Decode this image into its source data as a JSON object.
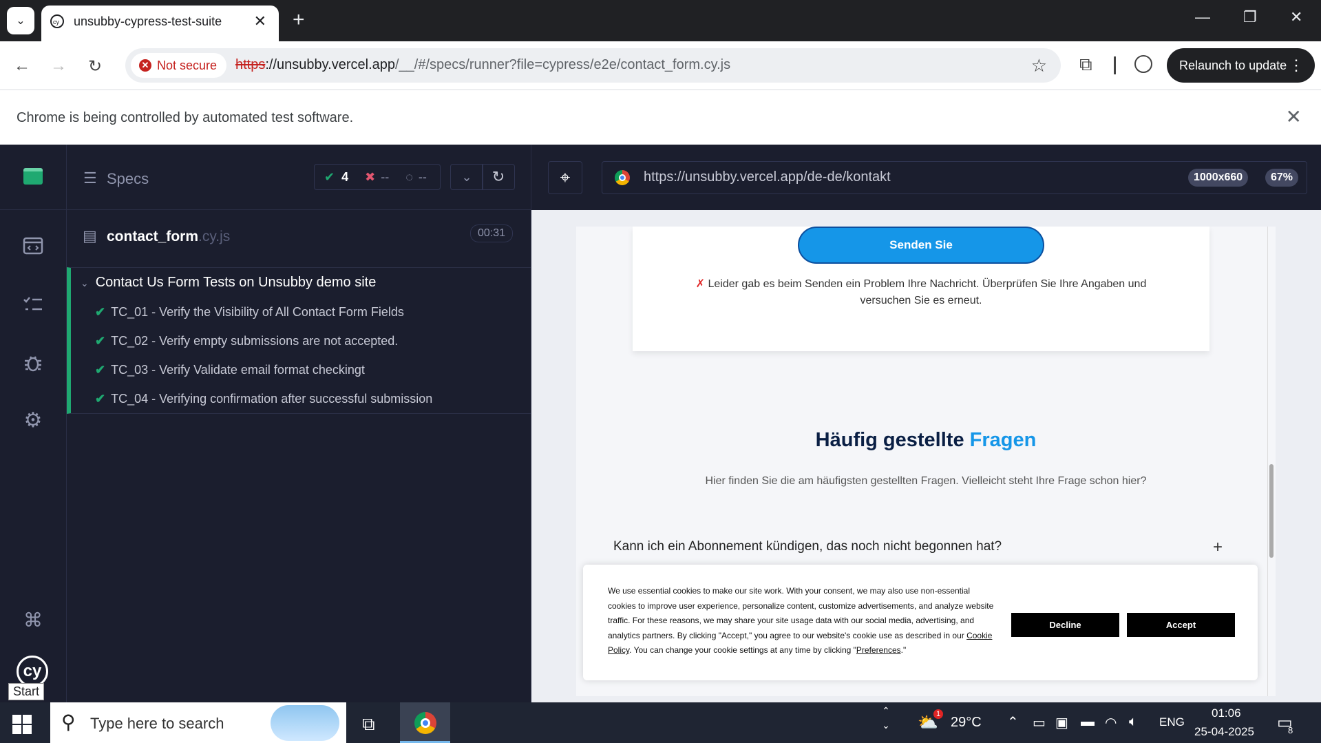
{
  "browser": {
    "tab_title": "unsubby-cypress-test-suite",
    "not_secure_label": "Not secure",
    "url_proto": "https",
    "url_host": "://unsubby.vercel.app",
    "url_path": "/__/#/specs/runner?file=cypress/e2e/contact_form.cy.js",
    "relaunch_label": "Relaunch to update",
    "infobar_message": "Chrome is being controlled by automated test software."
  },
  "cypress": {
    "specs_label": "Specs",
    "stats": {
      "passed": "4",
      "failed": "--",
      "pending": "--"
    },
    "spec_file_name": "contact_form",
    "spec_file_ext": ".cy.js",
    "duration": "00:31",
    "suite_title": "Contact Us Form Tests on Unsubby demo site",
    "tests": [
      {
        "title": "TC_01 - Verify the Visibility of All Contact Form Fields",
        "status": "passed"
      },
      {
        "title": "TC_02 - Verify empty submissions are not accepted.",
        "status": "passed"
      },
      {
        "title": "TC_03 - Verify Validate email format checkingt",
        "status": "passed"
      },
      {
        "title": "TC_04 - Verifying confirmation after successful submission",
        "status": "passed"
      }
    ],
    "aut_url": "https://unsubby.vercel.app/de-de/kontakt",
    "viewport_size": "1000x660",
    "zoom": "67%",
    "start_tooltip": "Start"
  },
  "aut_page": {
    "send_button": "Senden Sie",
    "error_mark": "✗",
    "error_message": "Leider gab es beim Senden ein Problem Ihre Nachricht. Überprüfen Sie Ihre Angaben und versuchen Sie es erneut.",
    "faq_title_main": "Häufig gestellte ",
    "faq_title_accent": "Fragen",
    "faq_subtitle": "Hier finden Sie die am häufigsten gestellten Fragen. Vielleicht steht Ihre Frage schon hier?",
    "faq_question_1": "Kann ich ein Abonnement kündigen, das noch nicht begonnen hat?",
    "cookie_text_1": "We use essential cookies to make our site work. With your consent, we may also use non-essential cookies to improve user experience, personalize content, customize advertisements, and analyze website traffic. For these reasons, we may share your site usage data with our social media, advertising, and analytics partners. By clicking \"Accept,\" you agree to our website's cookie use as described in our ",
    "cookie_policy_link": "Cookie Policy",
    "cookie_text_2": ". You can change your cookie settings at any time by clicking \"",
    "preferences_link": "Preferences",
    "cookie_text_3": ".\"",
    "decline_label": "Decline",
    "accept_label": "Accept"
  },
  "taskbar": {
    "search_placeholder": "Type here to search",
    "weather_badge": "1",
    "temperature": "29°C",
    "language": "ENG",
    "time": "01:06",
    "date": "25-04-2025",
    "notification_count": "8"
  }
}
